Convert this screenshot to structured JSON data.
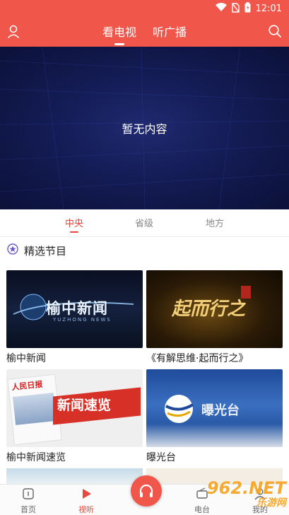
{
  "status_bar": {
    "time": "12:01"
  },
  "header": {
    "tabs": [
      {
        "label": "看电视",
        "active": true
      },
      {
        "label": "听广播",
        "active": false
      }
    ]
  },
  "player": {
    "message": "暂无内容"
  },
  "subtabs": [
    {
      "label": "中央",
      "active": true
    },
    {
      "label": "省级",
      "active": false
    },
    {
      "label": "地方",
      "active": false
    }
  ],
  "section": {
    "title": "精选节目"
  },
  "programs": [
    {
      "name": "榆中新闻",
      "thumb_text": "榆中新闻",
      "thumb_sub": "YUZHONG NEWS"
    },
    {
      "name": "《有解思维·起而行之》",
      "thumb_text": "起而行之",
      "thumb_sub": ""
    },
    {
      "name": "榆中新闻速览",
      "thumb_text": "新闻速览",
      "thumb_sub": "人民日报"
    },
    {
      "name": "曝光台",
      "thumb_text": "曝光台",
      "thumb_sub": ""
    }
  ],
  "bottom_nav": {
    "items": [
      {
        "label": "首页",
        "active": false
      },
      {
        "label": "视听",
        "active": true
      },
      {
        "label": "电台",
        "active": false
      },
      {
        "label": "我的",
        "active": false
      }
    ]
  },
  "watermark": {
    "brand": "962.NET",
    "sub": "乐游网"
  },
  "colors": {
    "brand_red": "#f0564a",
    "accent": "#e8473b",
    "player_bg": "#141c55"
  }
}
